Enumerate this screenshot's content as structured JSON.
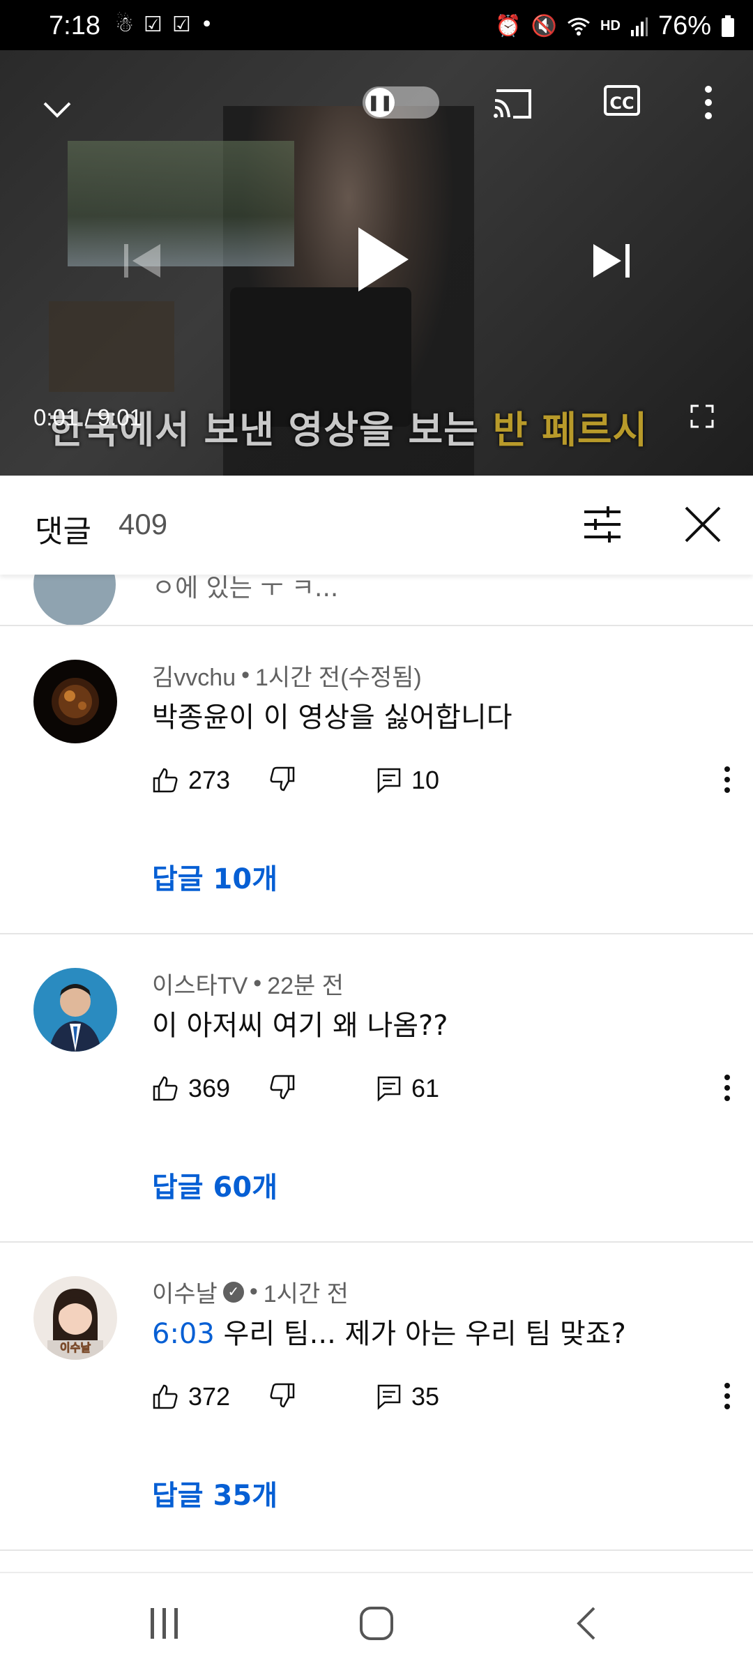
{
  "status_bar": {
    "time": "7:18",
    "battery": "76%",
    "icons": [
      "notification-icon",
      "check-icon",
      "check-icon",
      "dot-icon",
      "alarm-icon",
      "mute-icon",
      "wifi-icon",
      "hd-voice-icon",
      "signal-icon",
      "battery-icon"
    ]
  },
  "player": {
    "subtitle_part1": "한국에서 보낸 영상을 보는",
    "subtitle_highlight": "반 페르시",
    "time": "0:01 / 9:01",
    "progress_fraction": 0.002,
    "cc_label": "CC"
  },
  "comments": {
    "title": "댓글",
    "count": "409",
    "partial_text": "ㅇ에 있는 ㅜ ㅋ...",
    "items": [
      {
        "author": "김vvchu",
        "time": "1시간 전(수정됨)",
        "verified": false,
        "timestamp_link": "",
        "text": "박종윤이 이 영상을 싫어합니다",
        "likes": "273",
        "replies": "10",
        "replies_link": "답글 10개"
      },
      {
        "author": "이스타TV",
        "time": "22분 전",
        "verified": false,
        "timestamp_link": "",
        "text": "이 아저씨 여기 왜 나옴??",
        "likes": "369",
        "replies": "61",
        "replies_link": "답글 60개"
      },
      {
        "author": "이수날",
        "time": "1시간 전",
        "verified": true,
        "timestamp_link": "6:03",
        "text": " 우리 팀... 제가 아는 우리 팀 맞죠?",
        "likes": "372",
        "replies": "35",
        "replies_link": "답글 35개",
        "avatar_label": "이수날"
      }
    ],
    "separator": "•"
  },
  "colors": {
    "accent_blue": "#065fd4",
    "progress_red": "#ff0000"
  }
}
